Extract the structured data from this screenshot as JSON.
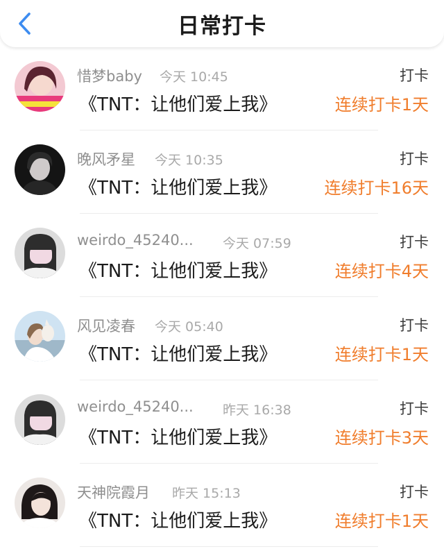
{
  "header": {
    "title": "日常打卡",
    "back_icon": "chevron-left-icon",
    "back_color": "#3d8cf0"
  },
  "colors": {
    "streak": "#f07d2c",
    "username": "#8f8f8f",
    "time": "#a9a9a9"
  },
  "entries": [
    {
      "user": "惜梦baby",
      "time": "今天 10:45",
      "book": "《TNT：让他们爱上我》",
      "action": "打卡",
      "streak": "连续打卡1天",
      "avatar": "avatar-pink-photo"
    },
    {
      "user": "晚风矛星",
      "time": "今天 10:35",
      "book": "《TNT：让他们爱上我》",
      "action": "打卡",
      "streak": "连续打卡16天",
      "avatar": "avatar-dark-photo"
    },
    {
      "user": "weirdo_45240...",
      "time": "今天 07:59",
      "book": "《TNT：让他们爱上我》",
      "action": "打卡",
      "streak": "连续打卡4天",
      "avatar": "avatar-masked-photo"
    },
    {
      "user": "风见凌春",
      "time": "今天 05:40",
      "book": "《TNT：让他们爱上我》",
      "action": "打卡",
      "streak": "连续打卡1天",
      "avatar": "avatar-outdoor-photo"
    },
    {
      "user": "weirdo_45240...",
      "time": "昨天 16:38",
      "book": "《TNT：让他们爱上我》",
      "action": "打卡",
      "streak": "连续打卡3天",
      "avatar": "avatar-masked-photo"
    },
    {
      "user": "天神院霞月",
      "time": "昨天 15:13",
      "book": "《TNT：让他们爱上我》",
      "action": "打卡",
      "streak": "连续打卡1天",
      "avatar": "avatar-portrait-photo"
    }
  ]
}
